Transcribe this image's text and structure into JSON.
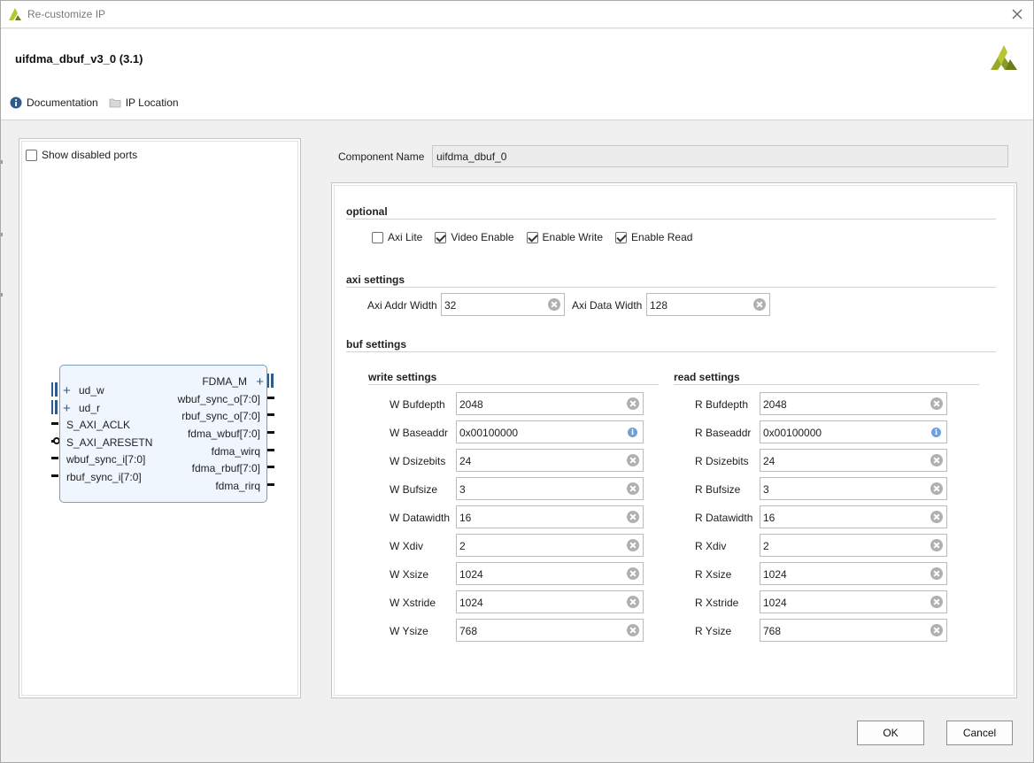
{
  "window": {
    "title": "Re-customize IP",
    "ip_name": "uifdma_dbuf_v3_0 (3.1)",
    "brand_colors": {
      "logo_dark": "#6e7b1a",
      "logo_light": "#b8c532",
      "accent": "#2e5a8c"
    }
  },
  "header_links": [
    {
      "label": "Documentation",
      "icon": "info-icon"
    },
    {
      "label": "IP Location",
      "icon": "folder-icon"
    }
  ],
  "left_panel": {
    "show_disabled_ports": {
      "label": "Show disabled ports",
      "checked": false
    },
    "block": {
      "left_ports": [
        "ud_w",
        "ud_r",
        "S_AXI_ACLK",
        "S_AXI_ARESETN",
        "wbuf_sync_i[7:0]",
        "rbuf_sync_i[7:0]"
      ],
      "right_ports": [
        "FDMA_M",
        "wbuf_sync_o[7:0]",
        "rbuf_sync_o[7:0]",
        "fdma_wbuf[7:0]",
        "fdma_wirq",
        "fdma_rbuf[7:0]",
        "fdma_rirq"
      ]
    }
  },
  "component": {
    "label": "Component Name",
    "value": "uifdma_dbuf_0"
  },
  "optional": {
    "title": "optional",
    "items": [
      {
        "label": "Axi Lite",
        "checked": false
      },
      {
        "label": "Video Enable",
        "checked": true
      },
      {
        "label": "Enable Write",
        "checked": true
      },
      {
        "label": "Enable Read",
        "checked": true
      }
    ]
  },
  "axi": {
    "title": "axi settings",
    "addr_width": {
      "label": "Axi Addr Width",
      "value": "32"
    },
    "data_width": {
      "label": "Axi Data Width",
      "value": "128"
    }
  },
  "buf": {
    "title": "buf settings",
    "write": {
      "title": "write settings",
      "fields": [
        {
          "label": "W Bufdepth",
          "value": "2048"
        },
        {
          "label": "W Baseaddr",
          "value": "0x00100000"
        },
        {
          "label": "W Dsizebits",
          "value": "24"
        },
        {
          "label": "W Bufsize",
          "value": "3"
        },
        {
          "label": "W Datawidth",
          "value": "16"
        },
        {
          "label": "W Xdiv",
          "value": "2"
        },
        {
          "label": "W Xsize",
          "value": "1024"
        },
        {
          "label": "W Xstride",
          "value": "1024"
        },
        {
          "label": "W Ysize",
          "value": "768"
        }
      ]
    },
    "read": {
      "title": "read settings",
      "fields": [
        {
          "label": "R Bufdepth",
          "value": "2048"
        },
        {
          "label": "R Baseaddr",
          "value": "0x00100000"
        },
        {
          "label": "R Dsizebits",
          "value": "24"
        },
        {
          "label": "R Bufsize",
          "value": "3"
        },
        {
          "label": "R Datawidth",
          "value": "16"
        },
        {
          "label": "R Xdiv",
          "value": "2"
        },
        {
          "label": "R Xsize",
          "value": "1024"
        },
        {
          "label": "R Xstride",
          "value": "1024"
        },
        {
          "label": "R Ysize",
          "value": "768"
        }
      ]
    }
  },
  "buttons": {
    "ok": "OK",
    "cancel": "Cancel"
  }
}
